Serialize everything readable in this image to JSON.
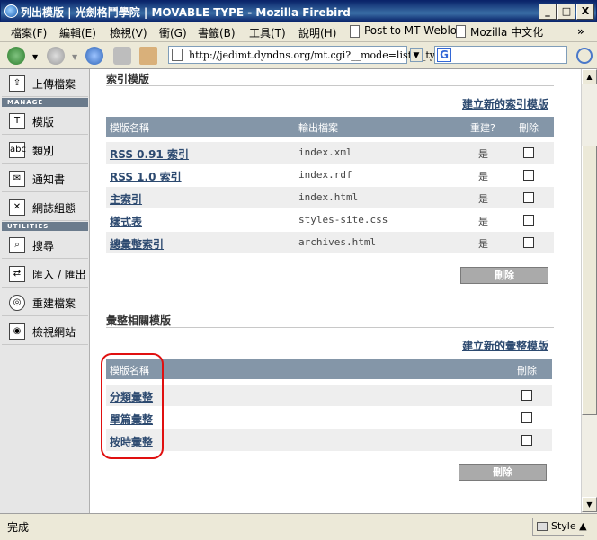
{
  "window": {
    "title": "列出模版 | 光劍格鬥學院 | MOVABLE TYPE - Mozilla Firebird",
    "buttons": {
      "minimize": "_",
      "maximize": "□",
      "close": "X"
    }
  },
  "menubar": {
    "items": [
      "檔案(F)",
      "編輯(E)",
      "檢視(V)",
      "衝(G)",
      "書籤(B)",
      "工具(T)",
      "說明(H)"
    ],
    "bookmarks": [
      "Post to MT Weblog",
      "Mozilla 中文化"
    ],
    "overflow": "»"
  },
  "toolbar": {
    "url": "http://jedimt.dyndns.org/mt.cgi?__mode=list&_type=",
    "search_placeholder": ""
  },
  "sidebar": {
    "upload": "上傳檔案",
    "manage_heading": "MANAGE",
    "manage_items": [
      "模版",
      "類別",
      "通知書",
      "網誌組態"
    ],
    "utilities_heading": "UTILITIES",
    "utility_items": [
      "搜尋",
      "匯入 / 匯出",
      "重建檔案",
      "檢視網站"
    ]
  },
  "index_section": {
    "title": "索引模版",
    "new_link": "建立新的索引模版",
    "headers": {
      "name": "模版名稱",
      "output": "輸出檔案",
      "rebuild": "重建?",
      "delete": "刪除"
    },
    "rows": [
      {
        "name": "RSS 0.91 索引",
        "file": "index.xml",
        "rebuild": "是"
      },
      {
        "name": "RSS 1.0 索引",
        "file": "index.rdf",
        "rebuild": "是"
      },
      {
        "name": "主索引",
        "file": "index.html",
        "rebuild": "是"
      },
      {
        "name": "樣式表",
        "file": "styles-site.css",
        "rebuild": "是"
      },
      {
        "name": "總彙整索引",
        "file": "archives.html",
        "rebuild": "是"
      }
    ],
    "delete_button": "刪除"
  },
  "archive_section": {
    "title": "彙整相關模版",
    "new_link": "建立新的彙整模版",
    "headers": {
      "name": "模版名稱",
      "delete": "刪除"
    },
    "rows": [
      {
        "name": "分類彙整"
      },
      {
        "name": "單篇彙整"
      },
      {
        "name": "按時彙整"
      }
    ],
    "delete_button": "刪除"
  },
  "statusbar": {
    "status": "完成",
    "style_button": "Style"
  }
}
